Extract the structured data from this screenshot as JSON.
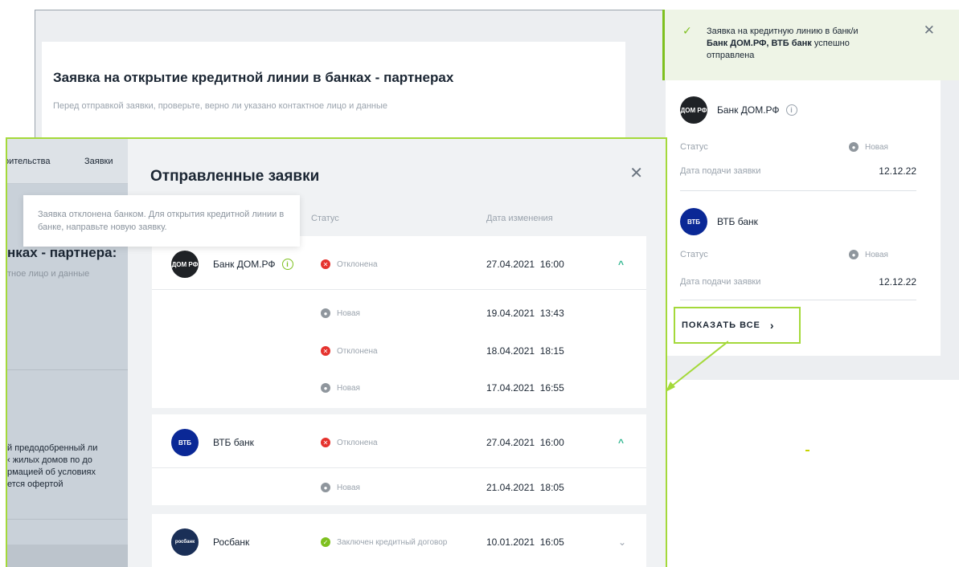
{
  "background": {
    "title": "Заявка на открытие кредитной линии в банках - партнерах",
    "subtitle": "Перед отправкой заявки, проверьте, верно ли указано контактное лицо и данные"
  },
  "toast": {
    "line1": "Заявка на кредитную линию в банк/и",
    "bold": "Банк ДОМ.РФ, ВТБ банк",
    "line2": "успешно",
    "line3": "отправлена",
    "close": "✕"
  },
  "right_card": {
    "banks": [
      {
        "name": "Банк ДОМ.РФ",
        "logo": "ДОМ РФ",
        "status_label": "Статус",
        "status": "Новая",
        "date_label": "Дата подачи заявки",
        "date": "12.12.22"
      },
      {
        "name": "ВТБ банк",
        "logo": "ВТБ",
        "status_label": "Статус",
        "status": "Новая",
        "date_label": "Дата подачи заявки",
        "date": "12.12.22"
      }
    ],
    "show_all": "ПОКАЗАТЬ ВСЕ"
  },
  "mask": {
    "tab1": "оительства",
    "tab2": "Заявки",
    "heading": "нках - партнера:",
    "sub": "тное лицо и данные",
    "para": [
      "й предодобренный ли",
      "‹ жилых домов по до",
      "рмацией об условиях",
      "ется офертой"
    ]
  },
  "modal": {
    "title": "Отправленные заявки",
    "close": "✕",
    "columns": {
      "status": "Статус",
      "date": "Дата изменения"
    },
    "tooltip": "Заявка отклонена банком. Для открытия кредитной линии в банке, направьте новую заявку.",
    "groups": [
      {
        "bank": "Банк ДОМ.РФ",
        "logo": "ДОМ РФ",
        "rows": [
          {
            "status": "Отклонена",
            "date": "27.04.2021",
            "time": "16:00"
          },
          {
            "status": "Новая",
            "date": "19.04.2021",
            "time": "13:43"
          },
          {
            "status": "Отклонена",
            "date": "18.04.2021",
            "time": "18:15"
          },
          {
            "status": "Новая",
            "date": "17.04.2021",
            "time": "16:55"
          }
        ]
      },
      {
        "bank": "ВТБ банк",
        "logo": "ВТБ",
        "rows": [
          {
            "status": "Отклонена",
            "date": "27.04.2021",
            "time": "16:00"
          },
          {
            "status": "Новая",
            "date": "21.04.2021",
            "time": "18:05"
          }
        ]
      },
      {
        "bank": "Росбанк",
        "logo": "росбанк",
        "rows": [
          {
            "status": "Заключен кредитный договор",
            "date": "10.01.2021",
            "time": "16:05"
          }
        ]
      }
    ]
  },
  "colors": {
    "accent_green": "#7ec01f",
    "highlight_green": "#a4d93a",
    "status_red": "#e5322d",
    "status_gray": "#8f969d"
  }
}
